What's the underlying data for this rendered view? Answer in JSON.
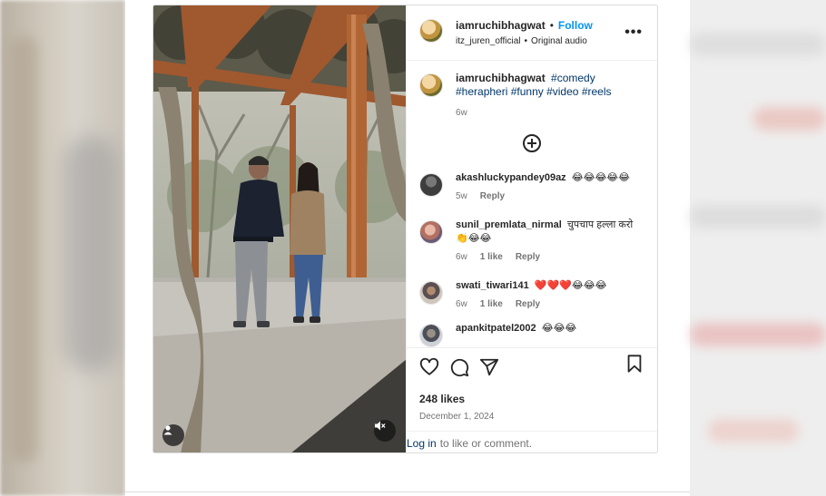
{
  "post": {
    "author": "iamruchibhagwat",
    "follow_label": "Follow",
    "dot": "•",
    "audio_user": "itz_juren_official",
    "audio_label": "Original audio",
    "more_label": "•••",
    "caption_tags": [
      "#comedy",
      "#herapheri",
      "#funny",
      "#video",
      "#reels"
    ],
    "caption_age": "6w",
    "likes": "248 likes",
    "date": "December 1, 2024",
    "login_link": "Log in",
    "login_text": "to like or comment."
  },
  "comments": [
    {
      "user": "akashluckypandey09az",
      "text": "😂😂😂😂😂",
      "age": "5w",
      "likes": "",
      "reply": "Reply"
    },
    {
      "user": "sunil_premlata_nirmal",
      "text": "चुपचाप हल्ला करो 👏😂😂",
      "age": "6w",
      "likes": "1 like",
      "reply": "Reply"
    },
    {
      "user": "swati_tiwari141",
      "text": "❤️❤️❤️😂😂😂",
      "age": "6w",
      "likes": "1 like",
      "reply": "Reply"
    },
    {
      "user": "apankitpatel2002",
      "text": "😂😂😂",
      "age": "",
      "likes": "",
      "reply": ""
    }
  ],
  "icons": {
    "like": "heart-icon",
    "comment": "comment-icon",
    "share": "share-icon",
    "save": "bookmark-icon",
    "load_more": "plus-circle-icon",
    "user_tag": "user-icon",
    "mute": "muted-speaker-icon"
  },
  "colors": {
    "follow": "#0095f6",
    "hashtag": "#00376b",
    "secondary_text": "#737373",
    "border": "#dbdbdb"
  }
}
